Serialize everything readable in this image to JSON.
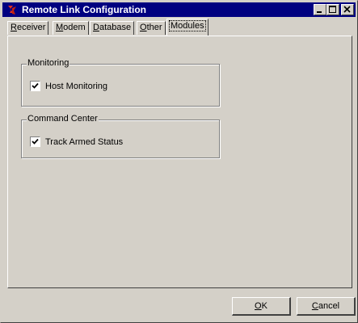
{
  "window": {
    "title": "Remote Link Configuration",
    "icon": "app-logo-icon",
    "controls": [
      "minimize-icon",
      "maximize-icon",
      "close-icon"
    ]
  },
  "tabs": [
    {
      "label_pre": "",
      "label_mnemonic": "R",
      "label_post": "eceiver"
    },
    {
      "label_pre": "",
      "label_mnemonic": "M",
      "label_post": "odem"
    },
    {
      "label_pre": "",
      "label_mnemonic": "D",
      "label_post": "atabase"
    },
    {
      "label_pre": "",
      "label_mnemonic": "O",
      "label_post": "ther"
    },
    {
      "label_pre": "",
      "label_mnemonic": "",
      "label_post": "Modules"
    }
  ],
  "active_tab": "Modules",
  "groups": {
    "monitoring": {
      "title": "Monitoring",
      "checkbox_label": "Host Monitoring",
      "checked": true
    },
    "command_center": {
      "title": "Command Center",
      "checkbox_label": "Track Armed Status",
      "checked": true
    }
  },
  "buttons": {
    "ok_mnemonic": "O",
    "ok_rest": "K",
    "cancel_mnemonic": "C",
    "cancel_rest": "ancel"
  },
  "colors": {
    "titlebar": "#000080",
    "face": "#d4d0c8"
  }
}
